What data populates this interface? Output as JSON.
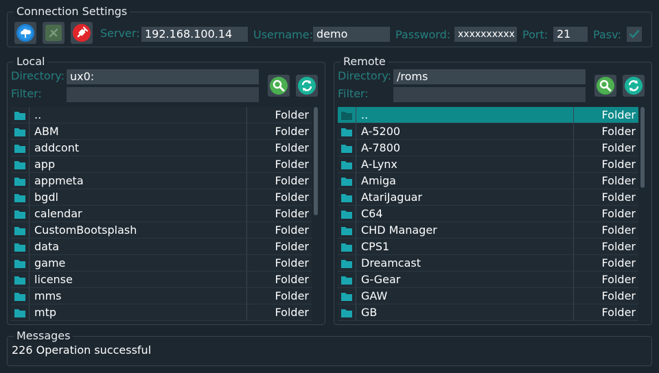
{
  "connection": {
    "title": "Connection Settings",
    "server_label": "Server:",
    "server_value": "192.168.100.14",
    "username_label": "Username:",
    "username_value": "demo",
    "password_label": "Password:",
    "password_value": "xxxxxxxxxx",
    "port_label": "Port:",
    "port_value": "21",
    "pasv_label": "Pasv:",
    "pasv_checked": true
  },
  "local": {
    "title": "Local",
    "directory_label": "Directory:",
    "directory_value": "ux0:",
    "filter_label": "Filter:",
    "filter_value": "",
    "rows": [
      {
        "name": "..",
        "type": "Folder"
      },
      {
        "name": "ABM",
        "type": "Folder"
      },
      {
        "name": "addcont",
        "type": "Folder"
      },
      {
        "name": "app",
        "type": "Folder"
      },
      {
        "name": "appmeta",
        "type": "Folder"
      },
      {
        "name": "bgdl",
        "type": "Folder"
      },
      {
        "name": "calendar",
        "type": "Folder"
      },
      {
        "name": "CustomBootsplash",
        "type": "Folder"
      },
      {
        "name": "data",
        "type": "Folder"
      },
      {
        "name": "game",
        "type": "Folder"
      },
      {
        "name": "license",
        "type": "Folder"
      },
      {
        "name": "mms",
        "type": "Folder"
      },
      {
        "name": "mtp",
        "type": "Folder"
      }
    ]
  },
  "remote": {
    "title": "Remote",
    "directory_label": "Directory:",
    "directory_value": "/roms",
    "filter_label": "Filter:",
    "filter_value": "",
    "rows": [
      {
        "name": "..",
        "type": "Folder"
      },
      {
        "name": "A-5200",
        "type": "Folder"
      },
      {
        "name": "A-7800",
        "type": "Folder"
      },
      {
        "name": "A-Lynx",
        "type": "Folder"
      },
      {
        "name": "Amiga",
        "type": "Folder"
      },
      {
        "name": "AtariJaguar",
        "type": "Folder"
      },
      {
        "name": "C64",
        "type": "Folder"
      },
      {
        "name": "CHD Manager",
        "type": "Folder"
      },
      {
        "name": "CPS1",
        "type": "Folder"
      },
      {
        "name": "Dreamcast",
        "type": "Folder"
      },
      {
        "name": "G-Gear",
        "type": "Folder"
      },
      {
        "name": "GAW",
        "type": "Folder"
      },
      {
        "name": "GB",
        "type": "Folder"
      }
    ]
  },
  "messages": {
    "title": "Messages",
    "text": "226 Operation successful"
  },
  "colors": {
    "accent": "#25807f",
    "selection": "#0e8a8a",
    "folder_icon": "#1aa6b0",
    "connect_button": "#1e7fd0",
    "disconnect_button": "#e0262a",
    "search_button": "#4caf50",
    "refresh_button": "#19b39a"
  },
  "icons": {
    "connect": "cloud-connect-icon",
    "disconnect_disabled": "disconnect-icon",
    "disconnect_active": "plug-off-icon",
    "search": "search-icon",
    "refresh": "refresh-icon",
    "folder": "folder-icon",
    "checkbox": "checkmark-icon"
  }
}
